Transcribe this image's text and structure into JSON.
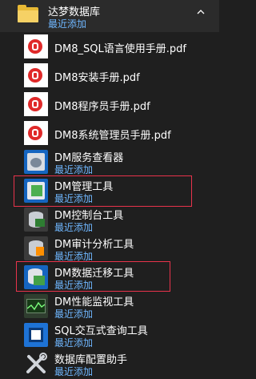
{
  "folder": {
    "title": "达梦数据库",
    "subtitle": "最近添加",
    "icon": "folder-icon",
    "expand_icon": "chevron-up-icon"
  },
  "items": [
    {
      "title": "DM8_SQL语言使用手册.pdf",
      "subtitle": "",
      "icon": "pdf-icon"
    },
    {
      "title": "DM8安装手册.pdf",
      "subtitle": "",
      "icon": "pdf-icon"
    },
    {
      "title": "DM8程序员手册.pdf",
      "subtitle": "",
      "icon": "pdf-icon"
    },
    {
      "title": "DM8系统管理员手册.pdf",
      "subtitle": "",
      "icon": "pdf-icon"
    },
    {
      "title": "DM服务查看器",
      "subtitle": "最近添加",
      "icon": "service-viewer-icon"
    },
    {
      "title": "DM管理工具",
      "subtitle": "最近添加",
      "icon": "management-tool-icon"
    },
    {
      "title": "DM控制台工具",
      "subtitle": "最近添加",
      "icon": "console-tool-icon"
    },
    {
      "title": "DM审计分析工具",
      "subtitle": "最近添加",
      "icon": "audit-tool-icon"
    },
    {
      "title": "DM数据迁移工具",
      "subtitle": "最近添加",
      "icon": "migration-tool-icon"
    },
    {
      "title": "DM性能监视工具",
      "subtitle": "最近添加",
      "icon": "performance-monitor-icon"
    },
    {
      "title": "SQL交互式查询工具",
      "subtitle": "最近添加",
      "icon": "sql-query-icon"
    },
    {
      "title": "数据库配置助手",
      "subtitle": "最近添加",
      "icon": "config-assistant-icon"
    }
  ],
  "colors": {
    "background": "#1f1f1f",
    "accent_text": "#6fb7ff",
    "highlight_border": "#e8334b"
  }
}
